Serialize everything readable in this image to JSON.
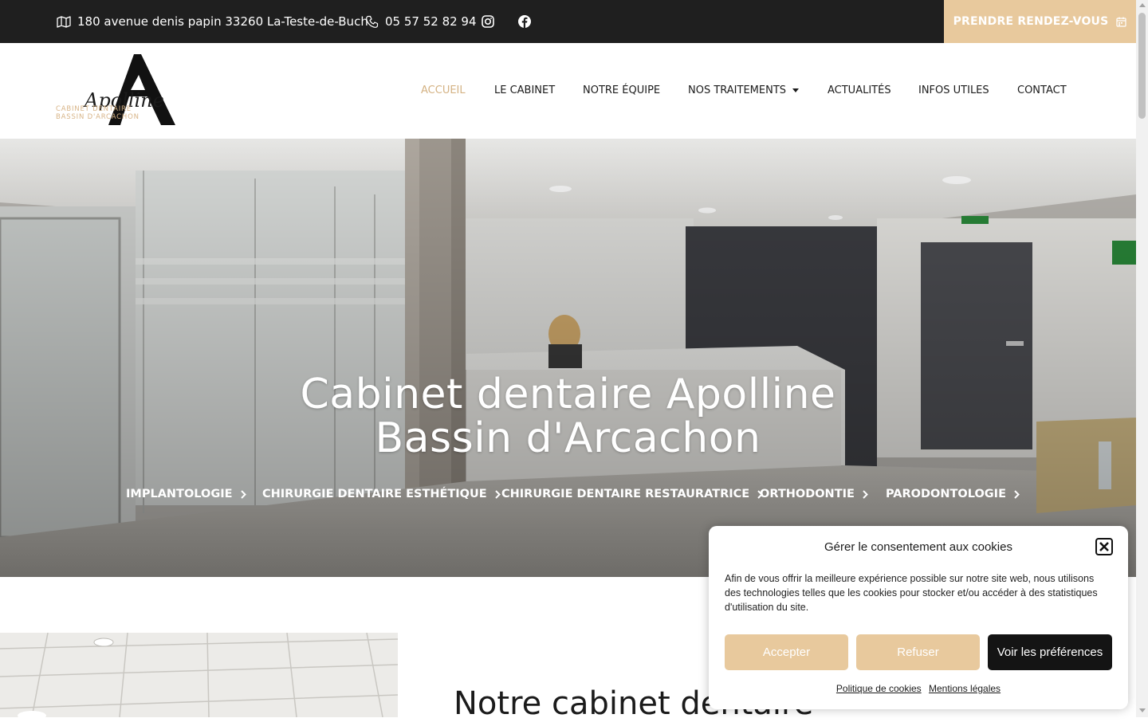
{
  "topbar": {
    "address": "180 avenue denis papin 33260 La-Teste-de-Buch",
    "phone": "05 57 52 82 94",
    "cta_label": "PRENDRE RENDEZ-VOUS",
    "icons": [
      "map-icon",
      "phone-icon",
      "instagram-icon",
      "facebook-icon",
      "calendar-icon"
    ]
  },
  "logo": {
    "name": "Apolline",
    "line1": "CABINET DENTAIRE",
    "line2": "BASSIN D'ARCACHON"
  },
  "nav": {
    "items": [
      {
        "label": "ACCUEIL",
        "active": true
      },
      {
        "label": "LE CABINET"
      },
      {
        "label": "NOTRE ÉQUIPE"
      },
      {
        "label": "NOS TRAITEMENTS",
        "dropdown": true
      },
      {
        "label": "ACTUALITÉS"
      },
      {
        "label": "INFOS UTILES"
      },
      {
        "label": "CONTACT"
      }
    ]
  },
  "hero": {
    "title_line1": "Cabinet dentaire Apolline",
    "title_line2": "Bassin d'Arcachon",
    "links": [
      "IMPLANTOLOGIE",
      "CHIRURGIE DENTAIRE ESTHÉTIQUE",
      "CHIRURGIE DENTAIRE RESTAURATRICE",
      "ORTHODONTIE",
      "PARODONTOLOGIE"
    ]
  },
  "section": {
    "title": "Notre cabinet dentaire"
  },
  "cookie": {
    "title": "Gérer le consentement aux cookies",
    "text": "Afin de vous offrir la meilleure expérience possible sur notre site web, nous utilisons des technologies telles que les cookies pour stocker et/ou accéder à des statistiques d'utilisation du site.",
    "accept": "Accepter",
    "refuse": "Refuser",
    "preferences": "Voir les préférences",
    "link_policy": "Politique de cookies",
    "link_legal": "Mentions légales"
  },
  "colors": {
    "accent": "#e8c99d",
    "dark": "#1f1f1f",
    "nav_active": "#d4b283"
  }
}
